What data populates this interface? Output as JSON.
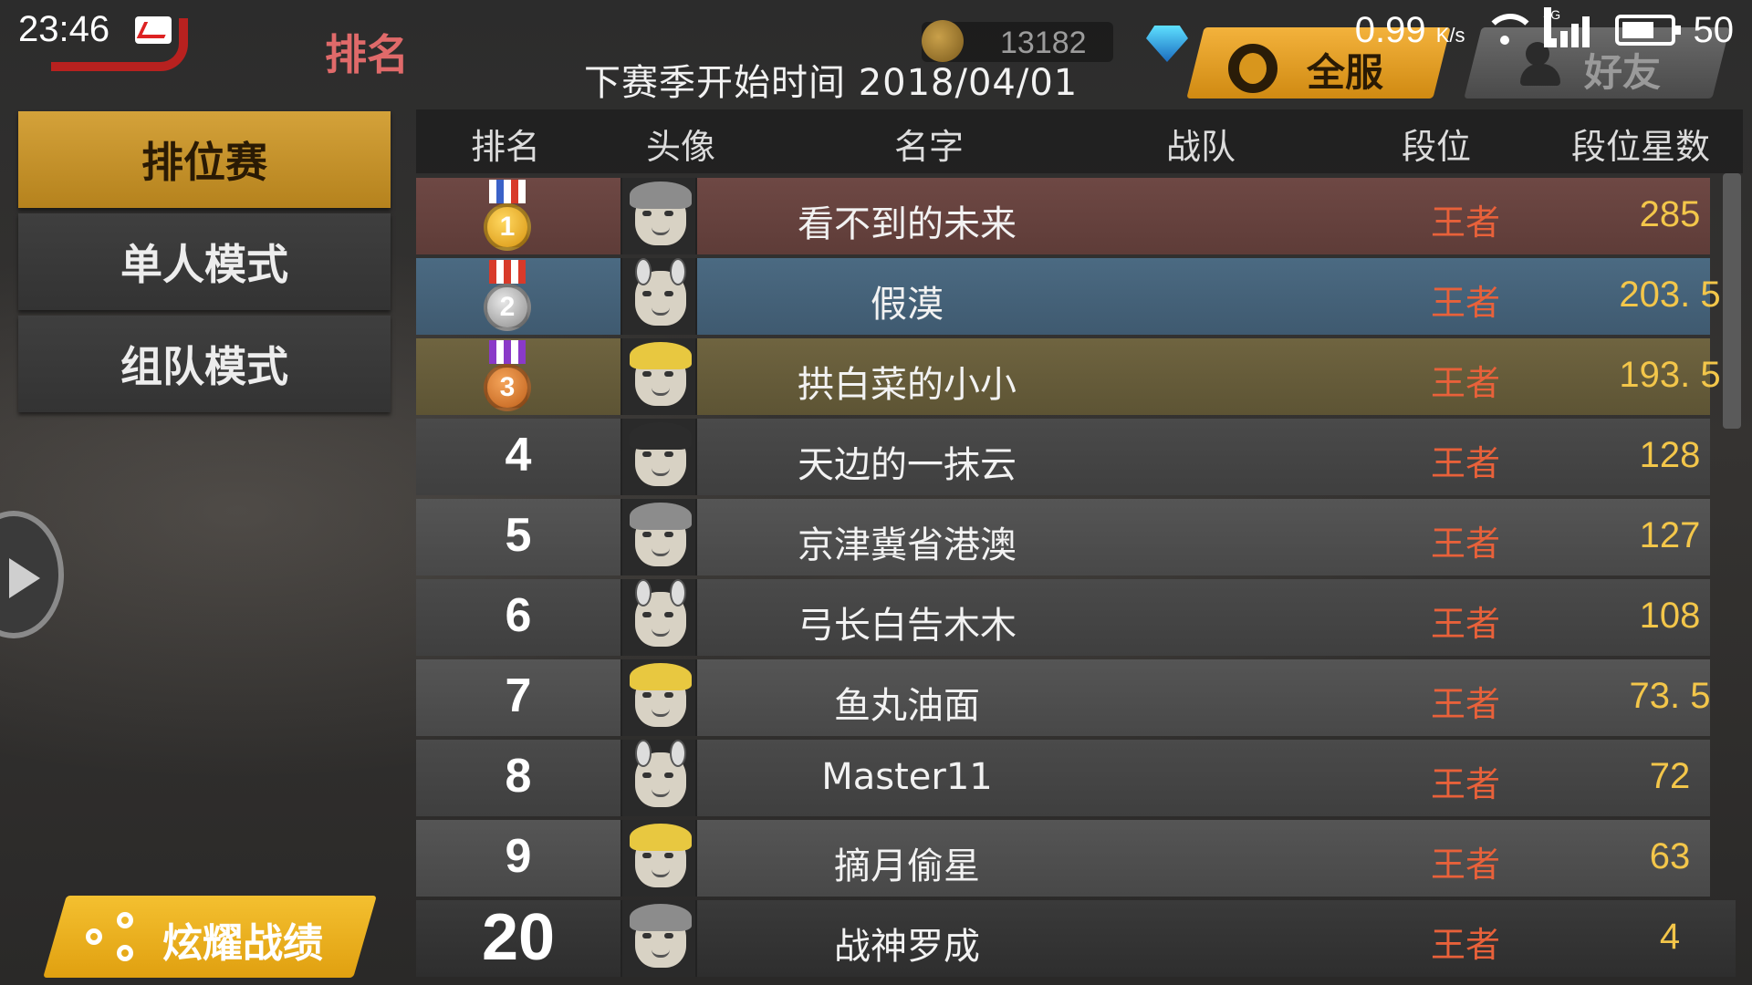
{
  "status_bar": {
    "time": "23:46",
    "net_speed": "0.99",
    "net_speed_unit": "K/s",
    "network_type": "4G",
    "battery": "50"
  },
  "header": {
    "title": "排名",
    "season_start_label": "下赛季开始时间  2018/04/01",
    "coins": "13182",
    "tab_all": "全服",
    "tab_friends": "好友"
  },
  "modes": [
    {
      "label": "排位赛",
      "active": true
    },
    {
      "label": "单人模式",
      "active": false
    },
    {
      "label": "组队模式",
      "active": false
    }
  ],
  "share_label": "炫耀战绩",
  "table": {
    "headers": [
      "排名",
      "头像",
      "名字",
      "战队",
      "段位",
      "段位星数"
    ],
    "rows": [
      {
        "rank": "1",
        "name": "看不到的未来",
        "team": "",
        "tier": "王者",
        "stars": "285",
        "style": "gold",
        "medal": "gold",
        "avatar": "gray-hair"
      },
      {
        "rank": "2",
        "name": "假漠",
        "team": "",
        "tier": "王者",
        "stars": "203. 5",
        "style": "silver",
        "medal": "silver",
        "avatar": "bunny-ears"
      },
      {
        "rank": "3",
        "name": "拱白菜的小小",
        "team": "",
        "tier": "王者",
        "stars": "193. 5",
        "style": "bronze",
        "medal": "bronze",
        "avatar": "blonde-goggles"
      },
      {
        "rank": "4",
        "name": "天边的一抹云",
        "team": "",
        "tier": "王者",
        "stars": "128",
        "style": "plain",
        "medal": "",
        "avatar": "dark-devil"
      },
      {
        "rank": "5",
        "name": "京津冀省港澳",
        "team": "",
        "tier": "王者",
        "stars": "127",
        "style": "plain-alt",
        "medal": "",
        "avatar": "gray-hair"
      },
      {
        "rank": "6",
        "name": "弓长白告木木",
        "team": "",
        "tier": "王者",
        "stars": "108",
        "style": "plain",
        "medal": "",
        "avatar": "bunny-ears"
      },
      {
        "rank": "7",
        "name": "鱼丸油面",
        "team": "",
        "tier": "王者",
        "stars": "73. 5",
        "style": "plain-alt",
        "medal": "",
        "avatar": "blonde-hair"
      },
      {
        "rank": "8",
        "name": "Master11",
        "team": "",
        "tier": "王者",
        "stars": "72",
        "style": "plain",
        "medal": "",
        "avatar": "bunny-ears"
      },
      {
        "rank": "9",
        "name": "摘月偷星",
        "team": "",
        "tier": "王者",
        "stars": "63",
        "style": "plain-alt",
        "medal": "",
        "avatar": "blonde-goggles"
      },
      {
        "rank": "20",
        "name": "战神罗成",
        "team": "",
        "tier": "王者",
        "stars": "4",
        "style": "highlight",
        "medal": "",
        "avatar": "gray-hair"
      }
    ]
  },
  "colors": {
    "accent_gold": "#d4a23a",
    "tier_red": "#e8613a",
    "stars_yellow": "#f3c64a",
    "title_red": "#e06a6a"
  }
}
